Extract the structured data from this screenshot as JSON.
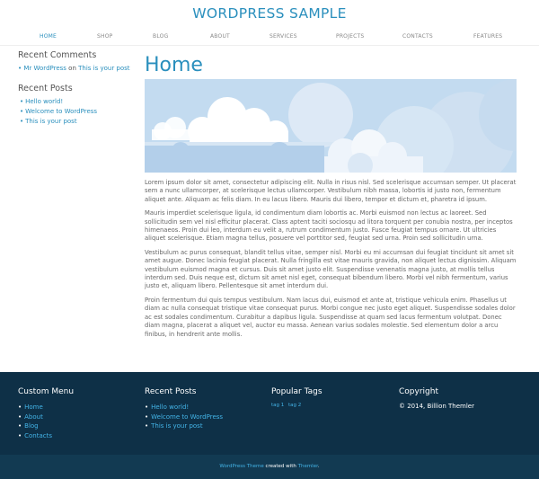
{
  "site": {
    "title": "WORDPRESS SAMPLE"
  },
  "nav": {
    "items": [
      "HOME",
      "SHOP",
      "BLOG",
      "ABOUT",
      "SERVICES",
      "PROJECTS",
      "CONTACTS",
      "FEATURES"
    ]
  },
  "sidebar": {
    "recent_comments": {
      "title": "Recent Comments",
      "author": "Mr WordPress",
      "on_text": " on ",
      "post": "This is your post"
    },
    "recent_posts": {
      "title": "Recent Posts",
      "items": [
        "Hello world!",
        "Welcome to WordPress",
        "This is your post"
      ]
    }
  },
  "main": {
    "title": "Home",
    "paragraphs": [
      "Lorem ipsum dolor sit amet, consectetur adipiscing elit. Nulla in risus nisl. Sed scelerisque accumsan semper. Ut placerat sem a nunc ullamcorper, at scelerisque lectus ullamcorper. Vestibulum nibh massa, lobortis id justo non, fermentum aliquet ante. Aliquam ac felis diam. In eu lacus libero. Mauris dui libero, tempor et dictum et, pharetra id ipsum.",
      "Mauris imperdiet scelerisque ligula, id condimentum diam lobortis ac. Morbi euismod non lectus ac laoreet. Sed sollicitudin sem vel nisl efficitur placerat. Class aptent taciti sociosqu ad litora torquent per conubia nostra, per inceptos himenaeos. Proin dui leo, interdum eu velit a, rutrum condimentum justo. Fusce feugiat tempus ornare. Ut ultricies aliquet scelerisque. Etiam magna tellus, posuere vel porttitor sed, feugiat sed urna. Proin sed sollicitudin urna.",
      "Vestibulum ac purus consequat, blandit tellus vitae, semper nisl. Morbi eu mi accumsan dui feugiat tincidunt sit amet sit amet augue. Donec lacinia feugiat placerat. Nulla fringilla est vitae mauris gravida, non aliquet lectus dignissim. Aliquam vestibulum euismod magna et cursus. Duis sit amet justo elit. Suspendisse venenatis magna justo, at mollis tellus interdum sed. Duis neque est, dictum sit amet nisl eget, consequat bibendum libero. Morbi vel nibh fermentum, varius justo et, aliquam libero. Pellentesque sit amet interdum dui.",
      "Proin fermentum dui quis tempus vestibulum. Nam lacus dui, euismod et ante at, tristique vehicula enim. Phasellus ut diam ac nulla consequat tristique vitae consequat purus. Morbi congue nec justo eget aliquet. Suspendisse sodales dolor ac est sodales condimentum. Curabitur a dapibus ligula. Suspendisse at quam sed lacus fermentum volutpat. Donec diam magna, placerat a aliquet vel, auctor eu massa. Aenean varius sodales molestie. Sed elementum dolor a arcu finibus, in hendrerit ante mollis."
    ]
  },
  "footer": {
    "custom_menu": {
      "title": "Custom Menu",
      "items": [
        "Home",
        "About",
        "Blog",
        "Contacts"
      ]
    },
    "recent_posts": {
      "title": "Recent Posts",
      "items": [
        "Hello world!",
        "Welcome to WordPress",
        "This is your post"
      ]
    },
    "popular_tags": {
      "title": "Popular Tags",
      "tags": [
        "tag 1",
        "tag 2"
      ]
    },
    "copyright": {
      "title": "Copyright",
      "text": "© 2014, Billion Themler"
    }
  },
  "bottom_bar": {
    "link1": "WordPress Theme",
    "middle": " created with ",
    "link2": "Themler",
    "end": "."
  },
  "colors": {
    "accent": "#2a8fbd",
    "footer_bg": "#0e3047",
    "bottom_bg": "#123a52",
    "hero_sky": "#bcd6ee"
  }
}
